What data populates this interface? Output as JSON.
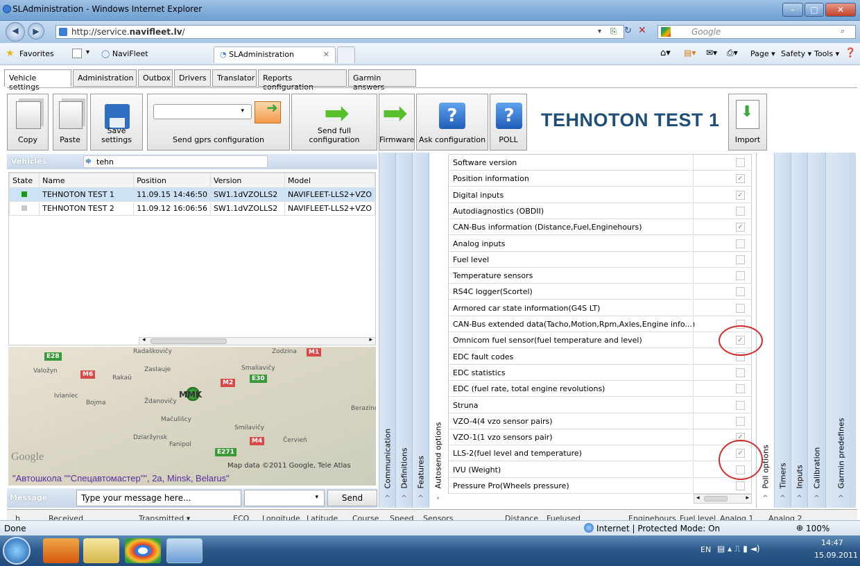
{
  "browser": {
    "title": "SLAdministration - Windows Internet Explorer",
    "url_prefix": "http://service.",
    "url_domain": "navifleet.lv",
    "url_suffix": "/",
    "search_placeholder": "Google",
    "favorites_label": "Favorites",
    "tabs": [
      {
        "label": "NaviFleet"
      },
      {
        "label": "SLAdministration"
      }
    ],
    "command_items": [
      "Page ▾",
      "Safety ▾",
      "Tools ▾"
    ]
  },
  "app_tabs": [
    "Vehicle settings",
    "Administration",
    "Outbox",
    "Drivers",
    "Translator",
    "Reports configuration",
    "Garmin answers"
  ],
  "toolbar": {
    "copy": "Copy",
    "paste": "Paste",
    "save": "Save settings",
    "send_gprs": "Send gprs configuration",
    "send_full": "Send full configuration",
    "firmware": "Firmware",
    "ask": "Ask configuration",
    "poll": "POLL",
    "import": "Import"
  },
  "vehicle_title": "TEHNOTON TEST 1",
  "vehicles_panel": {
    "header": "Vehicles",
    "search_value": "tehn",
    "columns": [
      "State",
      "Name",
      "Position",
      "Version",
      "Model"
    ],
    "rows": [
      {
        "state_color": "#1a9a1a",
        "name": "TEHNOTON TEST 1",
        "position": "11.09.15 14:46:50",
        "version": "SW1.1dVZOLLS2",
        "model": "NAVIFLEET-LLS2+VZO"
      },
      {
        "state_color": "#c8c8c8",
        "name": "TEHNOTON TEST 2",
        "position": "11.09.12 16:06:56",
        "version": "SW1.1dVZOLLS2",
        "model": "NAVIFLEET-LLS2+VZO"
      }
    ]
  },
  "map": {
    "places": [
      "Radaškovičy",
      "Valožyn",
      "Rakaŭ",
      "Zaslauje",
      "Smaliavičy",
      "Ivianiec",
      "Ždanovičy",
      "Mačulišcy",
      "Berazino",
      "Smilavičy",
      "Dziaržynsk",
      "Fanipol",
      "Červień",
      "Zodzina",
      "Bojma"
    ],
    "roads": [
      "E28",
      "M6",
      "M2",
      "E30",
      "M1",
      "M4",
      "E271"
    ],
    "marker": "MMK",
    "attribution": "Map data ©2011 Google, Tele Atlas",
    "logo": "Google",
    "address": "\"Автошкола \"\"Спецавтомастер\"\", 2а, Minsk, Belarus\""
  },
  "message": {
    "label": "Message",
    "placeholder": "Type your message here...",
    "send": "Send"
  },
  "side_tabs_left": [
    "Communication",
    "Definitions",
    "Features",
    "Autosend options"
  ],
  "side_tabs_right": [
    "Poll options",
    "Timers",
    "Inputs",
    "Calibration",
    "Garmin predefines"
  ],
  "options": [
    {
      "label": "Software version",
      "checked": false
    },
    {
      "label": "Position information",
      "checked": true
    },
    {
      "label": "Digital inputs",
      "checked": true
    },
    {
      "label": "Autodiagnostics (OBDII)",
      "checked": false
    },
    {
      "label": "CAN-Bus information (Distance,Fuel,Enginehours)",
      "checked": true
    },
    {
      "label": "Analog inputs",
      "checked": false
    },
    {
      "label": "Fuel level",
      "checked": false
    },
    {
      "label": "Temperature sensors",
      "checked": false
    },
    {
      "label": "RS4C logger(Scortel)",
      "checked": false
    },
    {
      "label": "Armored car state information(G4S LT)",
      "checked": false
    },
    {
      "label": "CAN-Bus extended data(Tacho,Motion,Rpm,Axles,Engine info...)",
      "checked": false
    },
    {
      "label": "Omnicom fuel sensor(fuel temperature and level)",
      "checked": true
    },
    {
      "label": "EDC fault codes",
      "checked": false
    },
    {
      "label": "EDC statistics",
      "checked": false
    },
    {
      "label": "EDC (fuel rate, total engine revolutions)",
      "checked": false
    },
    {
      "label": "Struna",
      "checked": false
    },
    {
      "label": "VZO-4(4 vzo sensor pairs)",
      "checked": false
    },
    {
      "label": "VZO-1(1 vzo sensors pair)",
      "checked": true
    },
    {
      "label": "LLS-2(fuel level and temperature)",
      "checked": true
    },
    {
      "label": "IVU (Weight)",
      "checked": false
    },
    {
      "label": "Pressure Pro(Wheels pressure)",
      "checked": false
    }
  ],
  "bottom_columns": [
    "h",
    "Received",
    "Transmitted ▾",
    "ECO",
    "Longitude",
    "Latitude",
    "Course",
    "Speed",
    "Sensors",
    "Distance",
    "Fuelused",
    "Enginehours",
    "Fuel level",
    "Analog 1",
    "Analog 2"
  ],
  "status": {
    "left": "Done",
    "zone": "Internet | Protected Mode: On",
    "zoom": "100%"
  },
  "taskbar": {
    "lang": "EN",
    "time": "14:47",
    "date": "15.09.2011"
  }
}
